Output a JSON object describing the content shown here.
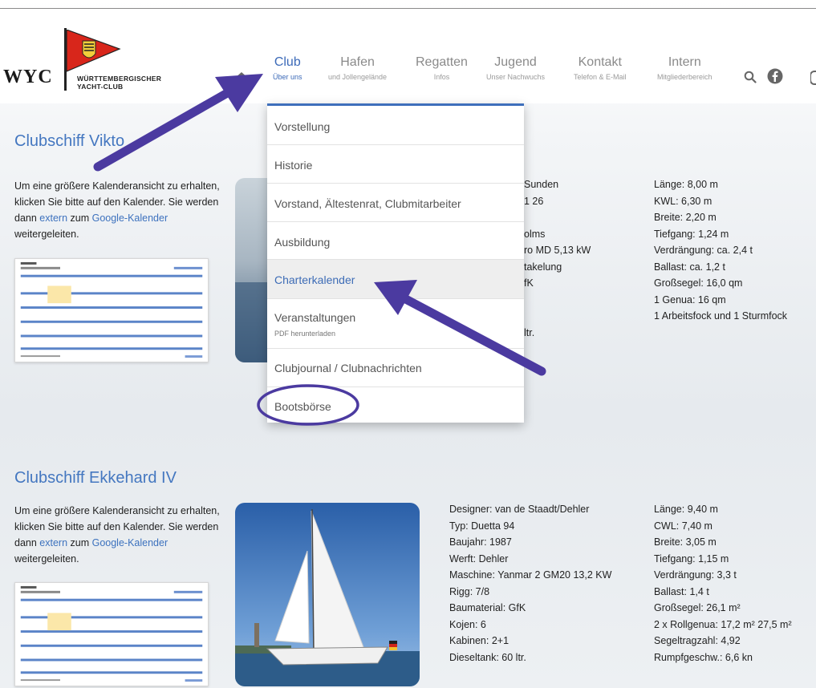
{
  "header": {
    "logo_letters": "WYC",
    "logo_line1": "WÜRTTEMBERGISCHER",
    "logo_line2": "YACHT-CLUB",
    "nav": [
      {
        "title": "Club",
        "sub": "Über uns"
      },
      {
        "title": "Hafen",
        "sub": "und Jollengelände"
      },
      {
        "title": "Regatten",
        "sub": "Infos"
      },
      {
        "title": "Jugend",
        "sub": "Unser Nachwuchs"
      },
      {
        "title": "Kontakt",
        "sub": "Telefon & E-Mail"
      },
      {
        "title": "Intern",
        "sub": "Mitgliederbereich"
      }
    ]
  },
  "dropdown": {
    "items": [
      {
        "label": "Vorstellung"
      },
      {
        "label": "Historie"
      },
      {
        "label": "Vorstand, Ältestenrat, Clubmitarbeiter"
      },
      {
        "label": "Ausbildung"
      },
      {
        "label": "Charterkalender"
      },
      {
        "label": "Veranstaltungen",
        "sub": "PDF herunterladen"
      },
      {
        "label": "Clubjournal / Clubnachrichten"
      },
      {
        "label": "Bootsbörse"
      }
    ]
  },
  "section1": {
    "title": "Clubschiff Vikto",
    "cal_text_a": "Um eine größere Kalenderansicht zu erhalten, klicken Sie bitte auf den Kalender. Sie werden dann ",
    "cal_link1": "extern",
    "cal_text_b": " zum ",
    "cal_link2": "Google-Kalender",
    "cal_text_c": " weitergeleiten.",
    "specs_mid": [
      "Sunden",
      "1 26",
      "",
      "olms",
      "ro MD 5,13 kW",
      "takelung",
      "fK",
      "",
      "",
      "ltr."
    ],
    "specs_right": [
      "Länge: 8,00 m",
      "KWL: 6,30 m",
      "Breite: 2,20 m",
      "Tiefgang: 1,24 m",
      "Verdrängung: ca. 2,4 t",
      "Ballast: ca. 1,2 t",
      "Großsegel: 16,0 qm",
      "1 Genua: 16 qm",
      "1 Arbeitsfock und 1 Sturmfock"
    ]
  },
  "section2": {
    "title": "Clubschiff Ekkehard IV",
    "cal_text_a": "Um eine größere Kalenderansicht zu erhalten, klicken Sie bitte auf den Kalender. Sie werden dann ",
    "cal_link1": "extern",
    "cal_text_b": " zum ",
    "cal_link2": "Google-Kalender",
    "cal_text_c": " weitergeleiten.",
    "specs_mid": [
      "Designer: van de Staadt/Dehler",
      "Typ: Duetta 94",
      "Baujahr: 1987",
      "Werft: Dehler",
      "Maschine: Yanmar 2 GM20 13,2 KW",
      "Rigg: 7/8",
      "Baumaterial: GfK",
      "Kojen: 6",
      "Kabinen: 2+1",
      "Dieseltank: 60 ltr."
    ],
    "specs_right": [
      "Länge: 9,40 m",
      "CWL: 7,40 m",
      "Breite: 3,05 m",
      "Tiefgang: 1,15 m",
      "Verdrängung: 3,3 t",
      "Ballast: 1,4 t",
      "Großsegel: 26,1 m²",
      "2 x Rollgenua: 17,2 m² 27,5 m²",
      "Segeltragzahl: 4,92",
      "Rumpfgeschw.: 6,6 kn"
    ]
  },
  "colors": {
    "accent": "#3e6fbb",
    "annotation": "#4b3aa0"
  },
  "icons": [
    "home-icon",
    "search-icon",
    "facebook-icon"
  ]
}
